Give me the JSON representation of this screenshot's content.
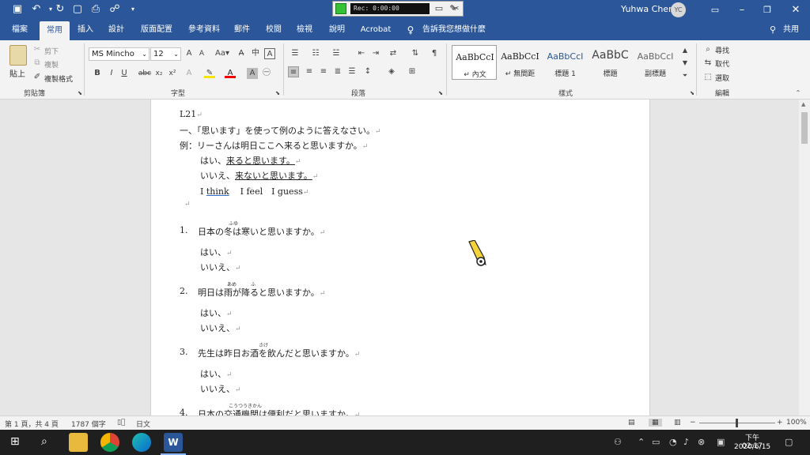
{
  "recorder": {
    "time": "Rec: 0:00:00"
  },
  "user": {
    "name": "Yuhwa Chen",
    "initials": "YC"
  },
  "tabs": [
    "檔案",
    "常用",
    "插入",
    "設計",
    "版面配置",
    "參考資料",
    "郵件",
    "校閱",
    "檢視",
    "說明",
    "Acrobat",
    "告訴我您想做什麼"
  ],
  "share_label": "共用",
  "clipboard": {
    "paste": "貼上",
    "cut": "剪下",
    "copy": "複製",
    "format_painter": "複製格式",
    "group": "剪貼簿"
  },
  "font": {
    "name": "MS Mincho",
    "size": "12",
    "group": "字型",
    "bold": "B",
    "italic": "I",
    "underline": "U"
  },
  "paragraph": {
    "group": "段落"
  },
  "styles": {
    "group": "樣式",
    "items": [
      {
        "sample": "AaBbCcI",
        "name": "↵ 內文"
      },
      {
        "sample": "AaBbCcI",
        "name": "↵ 無間距"
      },
      {
        "sample": "AaBbCcI",
        "name": "標題 1"
      },
      {
        "sample": "AaBbC",
        "name": "標題"
      },
      {
        "sample": "AaBbCcI",
        "name": "副標題"
      }
    ]
  },
  "editing": {
    "find": "尋找",
    "replace": "取代",
    "select": "選取",
    "group": "編輯"
  },
  "document": {
    "lines": {
      "title": "L21",
      "instruction": "一、「思います」を使って例のように答えなさい。",
      "example": "例：リーさんは明日ここへ来ると思いますか。",
      "ex_yes_prefix": "はい、",
      "ex_yes_ul": "来ると思います。",
      "ex_no_prefix": "いいえ、",
      "ex_no_ul": "来ないと思います。",
      "think_i": "I",
      "think_word": "think",
      "think_rest": "I feel　I guess",
      "q1_num": "1.",
      "q1": "日本の冬は寒いと思いますか。",
      "q1_ruby": "ふゆ",
      "q2_num": "2.",
      "q2": "明日は雨が降ると思いますか。",
      "q2_ruby1": "あめ",
      "q2_ruby2": "ふ",
      "q3_num": "3.",
      "q3": "先生は昨日お酒を飲んだと思いますか。",
      "q3_ruby": "さけ",
      "q4_num": "4.",
      "q4": "日本の交通機関は便利だと思いますか。",
      "q4_ruby": "こうつうきかん",
      "yes": "はい、",
      "no": "いいえ、",
      "return_mark": "↵"
    }
  },
  "status": {
    "page": "第 1 頁，共 4 頁",
    "words": "1787 個字",
    "lang": "日文",
    "zoom": "100%"
  },
  "taskbar": {
    "time": "下午 02:17",
    "date": "2020/6/15"
  }
}
